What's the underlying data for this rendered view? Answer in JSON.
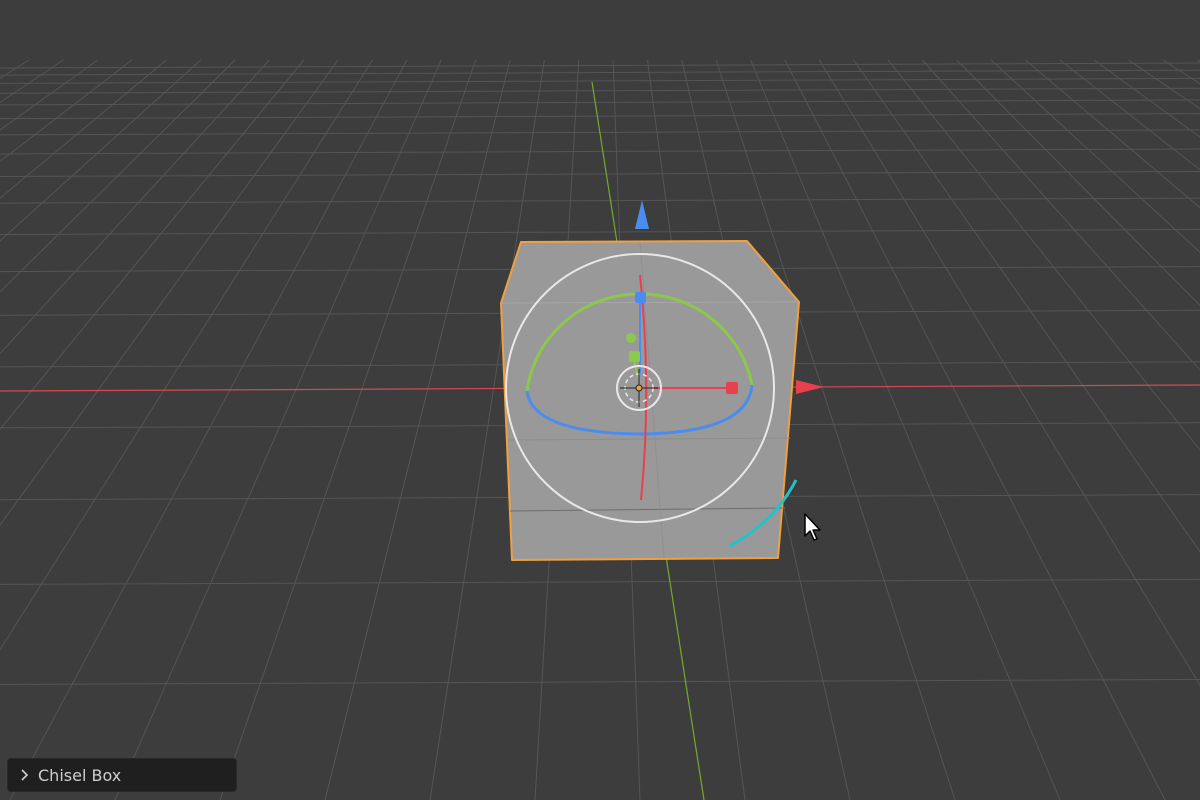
{
  "viewport": {
    "background": "#3d3d3d",
    "grid_color": "#5a5a5a",
    "x_axis_color": "#e04b5b",
    "y_axis_color": "#7fae2a",
    "selection_outline_color": "#f0a040",
    "object_fill": "#9a9a9a"
  },
  "gizmo": {
    "z_axis_color": "#4a8cf0",
    "x_axis_color": "#e8404f",
    "y_axis_color": "#8cc84b",
    "view_ring_color": "#e8e8e8",
    "trackball_color": "#22c2c8"
  },
  "last_operator_panel": {
    "label": "Chisel Box",
    "icon": "chevron-right-icon"
  },
  "cursor": {
    "icon": "mouse-pointer-icon"
  }
}
